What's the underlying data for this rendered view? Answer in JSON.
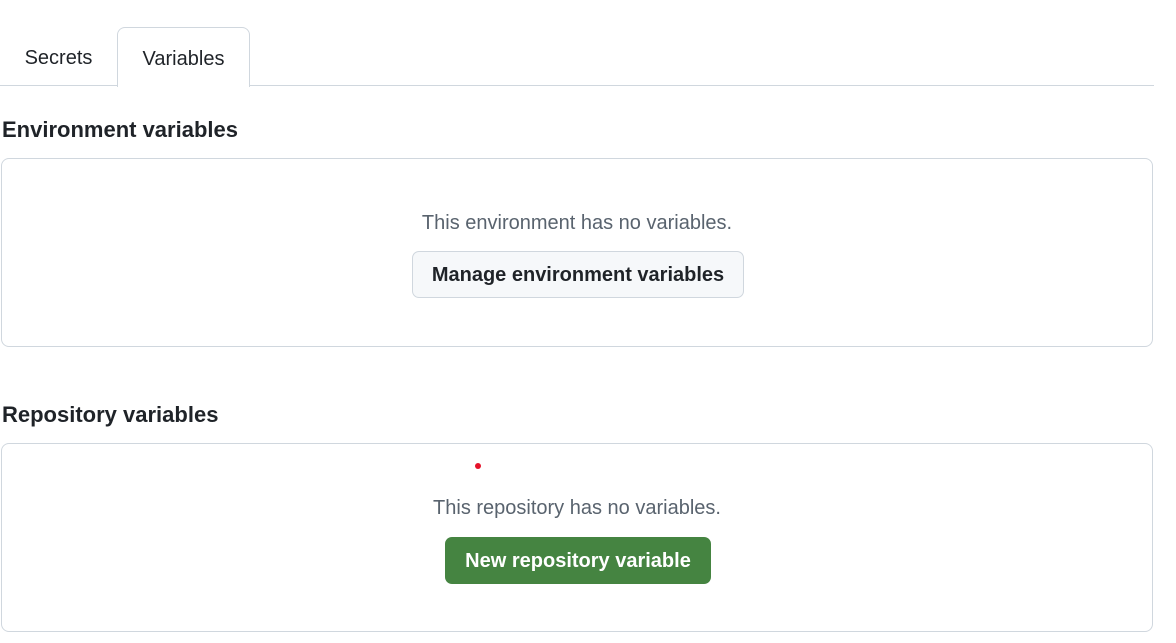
{
  "tabs": [
    {
      "label": "Secrets",
      "selected": false
    },
    {
      "label": "Variables",
      "selected": true
    }
  ],
  "environment": {
    "title": "Environment variables",
    "empty_text": "This environment has no variables.",
    "button_label": "Manage environment variables"
  },
  "repository": {
    "title": "Repository variables",
    "empty_text": "This repository has no variables.",
    "button_label": "New repository variable"
  },
  "colors": {
    "primary_button": "#458441",
    "border": "#d0d7de",
    "muted_text": "#59636e",
    "cursor": "#e5122a"
  }
}
